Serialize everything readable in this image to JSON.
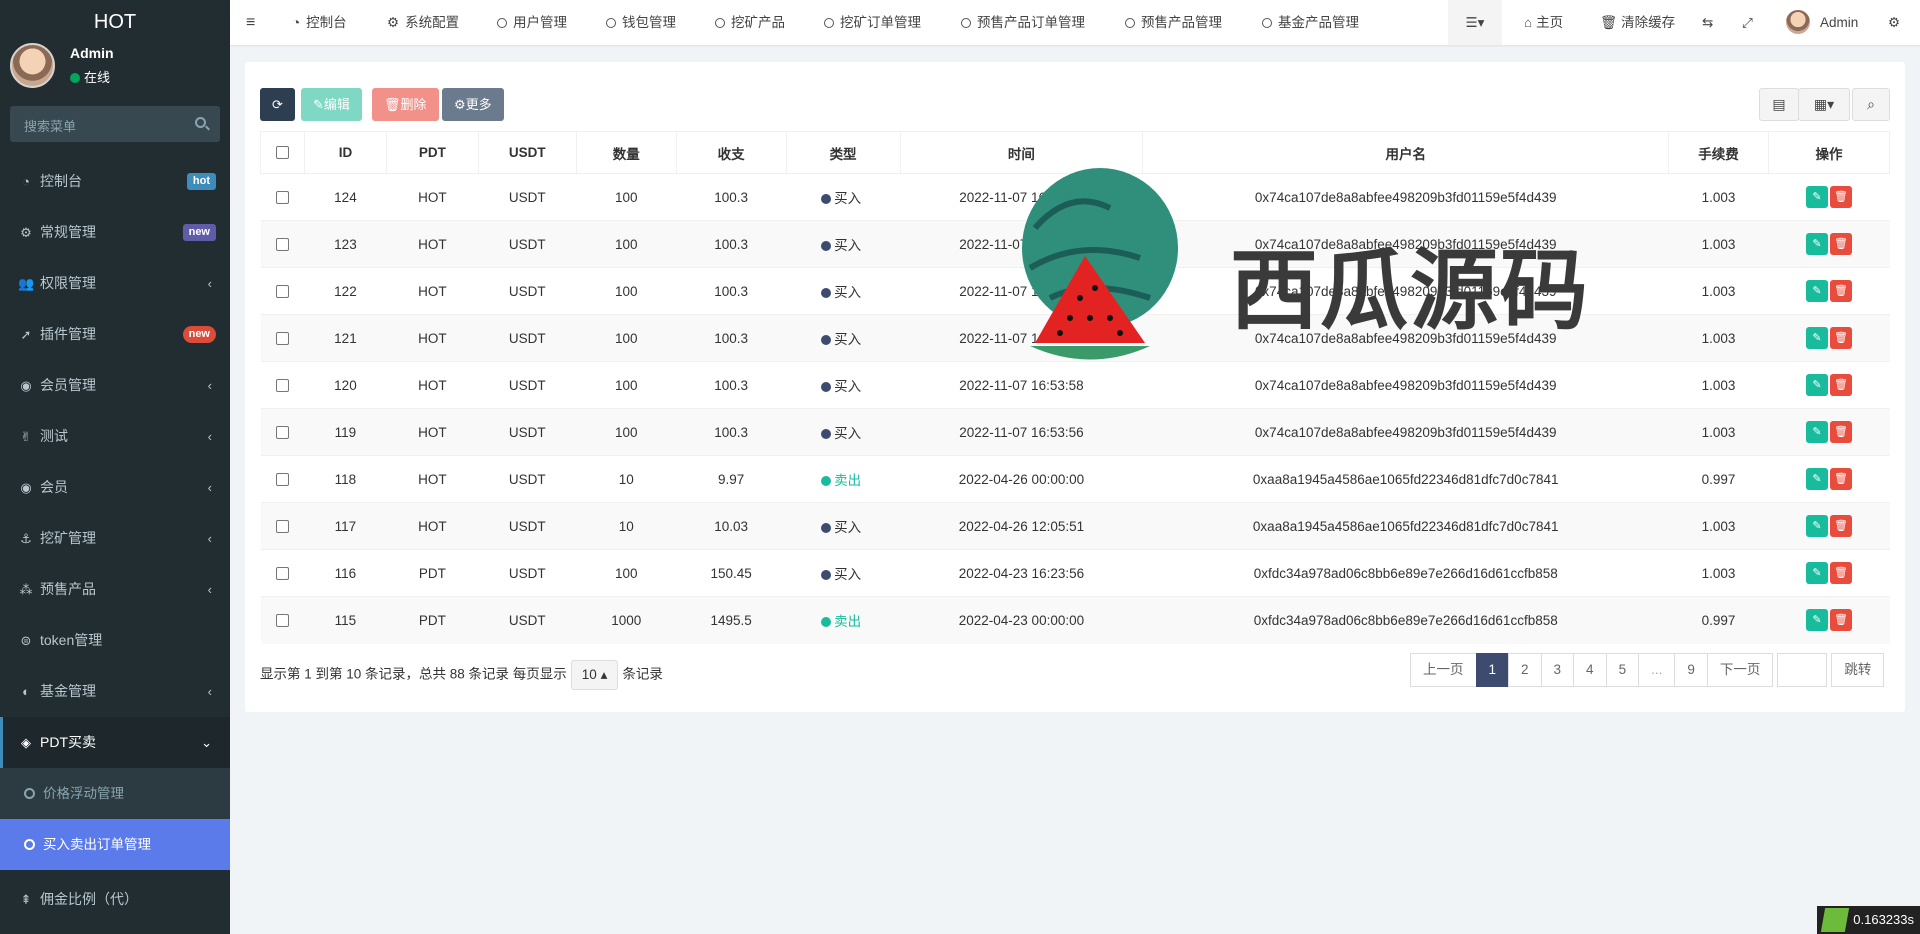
{
  "app": {
    "title": "HOT"
  },
  "user": {
    "name": "Admin",
    "status": "在线"
  },
  "search": {
    "placeholder": "搜索菜单"
  },
  "sidebar": {
    "items": [
      {
        "label": "控制台",
        "icon": "dashboard-icon",
        "badge": "hot",
        "badge_color": "#3c8dbc"
      },
      {
        "label": "常规管理",
        "icon": "cogs-icon",
        "badge": "new",
        "badge_color": "#605ca8"
      },
      {
        "label": "权限管理",
        "icon": "users-icon",
        "arrow": "‹"
      },
      {
        "label": "插件管理",
        "icon": "rocket-icon",
        "badge": "new",
        "badge_color": "#dd4b39"
      },
      {
        "label": "会员管理",
        "icon": "user-circle-icon",
        "arrow": "‹"
      },
      {
        "label": "测试",
        "icon": "medal-icon",
        "arrow": "‹"
      },
      {
        "label": "会员",
        "icon": "user-circle-icon",
        "arrow": "‹"
      },
      {
        "label": "挖矿管理",
        "icon": "anchor-icon",
        "arrow": "‹"
      },
      {
        "label": "预售产品",
        "icon": "sliders-icon",
        "arrow": "‹"
      },
      {
        "label": "token管理",
        "icon": "coin-icon"
      },
      {
        "label": "基金管理",
        "icon": "adjust-icon",
        "arrow": "‹"
      },
      {
        "label": "PDT买卖",
        "icon": "compass-icon",
        "arrow": "⌄"
      }
    ],
    "subitems": [
      {
        "label": "价格浮动管理"
      },
      {
        "label": "买入卖出订单管理"
      }
    ],
    "last_item": {
      "label": "佣金比例（代）",
      "icon": "tree-icon"
    }
  },
  "topbar": {
    "tabs": [
      {
        "label": "控制台",
        "icon": "dashboard-icon"
      },
      {
        "label": "系统配置",
        "icon": "gear-icon"
      },
      {
        "label": "用户管理"
      },
      {
        "label": "钱包管理"
      },
      {
        "label": "挖矿产品"
      },
      {
        "label": "挖矿订单管理"
      },
      {
        "label": "预售产品订单管理"
      },
      {
        "label": "预售产品管理"
      },
      {
        "label": "基金产品管理"
      }
    ],
    "home": "主页",
    "clear_cache": "清除缓存",
    "admin": "Admin"
  },
  "toolbar": {
    "edit": "编辑",
    "delete": "删除",
    "more": "更多"
  },
  "table": {
    "headers": [
      "ID",
      "PDT",
      "USDT",
      "数量",
      "收支",
      "类型",
      "时间",
      "用户名",
      "手续费",
      "操作"
    ],
    "rows": [
      {
        "id": "124",
        "pdt": "HOT",
        "usdt": "USDT",
        "qty": "100",
        "amount": "100.3",
        "type": "买入",
        "time": "2022-11-07 16:53:58",
        "user": "0x74ca107de8a8abfee498209b3fd01159e5f4d439",
        "fee": "1.003"
      },
      {
        "id": "123",
        "pdt": "HOT",
        "usdt": "USDT",
        "qty": "100",
        "amount": "100.3",
        "type": "买入",
        "time": "2022-11-07 16:53:58",
        "user": "0x74ca107de8a8abfee498209b3fd01159e5f4d439",
        "fee": "1.003"
      },
      {
        "id": "122",
        "pdt": "HOT",
        "usdt": "USDT",
        "qty": "100",
        "amount": "100.3",
        "type": "买入",
        "time": "2022-11-07 16:53:58",
        "user": "0x74ca107de8a8abfee498209b3fd01159e5f4d439",
        "fee": "1.003"
      },
      {
        "id": "121",
        "pdt": "HOT",
        "usdt": "USDT",
        "qty": "100",
        "amount": "100.3",
        "type": "买入",
        "time": "2022-11-07 16:53:58",
        "user": "0x74ca107de8a8abfee498209b3fd01159e5f4d439",
        "fee": "1.003"
      },
      {
        "id": "120",
        "pdt": "HOT",
        "usdt": "USDT",
        "qty": "100",
        "amount": "100.3",
        "type": "买入",
        "time": "2022-11-07 16:53:58",
        "user": "0x74ca107de8a8abfee498209b3fd01159e5f4d439",
        "fee": "1.003"
      },
      {
        "id": "119",
        "pdt": "HOT",
        "usdt": "USDT",
        "qty": "100",
        "amount": "100.3",
        "type": "买入",
        "time": "2022-11-07 16:53:56",
        "user": "0x74ca107de8a8abfee498209b3fd01159e5f4d439",
        "fee": "1.003"
      },
      {
        "id": "118",
        "pdt": "HOT",
        "usdt": "USDT",
        "qty": "10",
        "amount": "9.97",
        "type": "卖出",
        "time": "2022-04-26 00:00:00",
        "user": "0xaa8a1945a4586ae1065fd22346d81dfc7d0c7841",
        "fee": "0.997"
      },
      {
        "id": "117",
        "pdt": "HOT",
        "usdt": "USDT",
        "qty": "10",
        "amount": "10.03",
        "type": "买入",
        "time": "2022-04-26 12:05:51",
        "user": "0xaa8a1945a4586ae1065fd22346d81dfc7d0c7841",
        "fee": "1.003"
      },
      {
        "id": "116",
        "pdt": "PDT",
        "usdt": "USDT",
        "qty": "100",
        "amount": "150.45",
        "type": "买入",
        "time": "2022-04-23 16:23:56",
        "user": "0xfdc34a978ad06c8bb6e89e7e266d16d61ccfb858",
        "fee": "1.003"
      },
      {
        "id": "115",
        "pdt": "PDT",
        "usdt": "USDT",
        "qty": "1000",
        "amount": "1495.5",
        "type": "卖出",
        "time": "2022-04-23 00:00:00",
        "user": "0xfdc34a978ad06c8bb6e89e7e266d16d61ccfb858",
        "fee": "0.997"
      }
    ]
  },
  "pagination": {
    "info_prefix": "显示第 1 到第 10 条记录，总共 88 条记录 每页显示",
    "page_size": "10",
    "info_suffix": "条记录",
    "prev": "上一页",
    "pages": [
      "1",
      "2",
      "3",
      "4",
      "5",
      "...",
      "9"
    ],
    "next": "下一页",
    "jump": "跳转"
  },
  "watermark": {
    "text": "西瓜源码"
  },
  "timer": "0.163233s",
  "colors": {
    "buy": "#3c4b6e",
    "sell": "#18bc9c",
    "edit": "#18bc9c",
    "delete": "#e74c3c",
    "active_menu": "#5b7bea"
  }
}
